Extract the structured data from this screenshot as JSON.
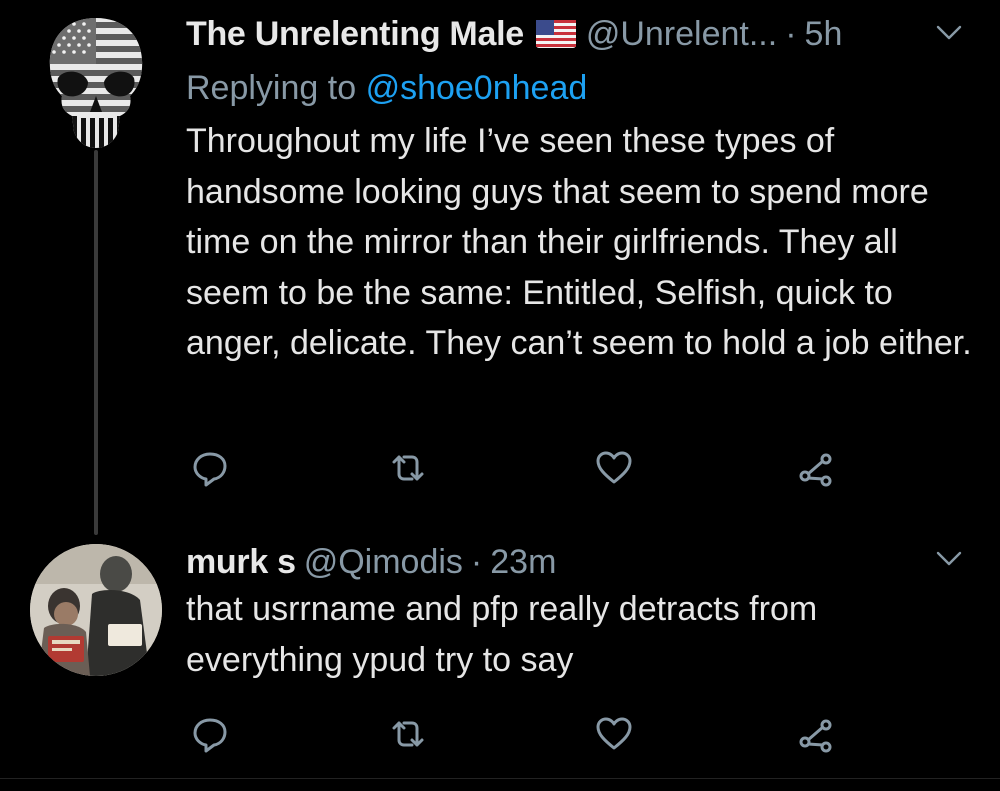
{
  "thread": [
    {
      "author": {
        "display_name": "The Unrelenting Male",
        "flag_icon": "us-flag-icon",
        "handle": "@Unrelent...",
        "separator": "·",
        "time": "5h"
      },
      "replying_to": {
        "prefix": "Replying to",
        "mention": "@shoe0nhead"
      },
      "text": "Throughout my life I’ve seen these types of handsome looking guys that seem to spend more time on the mirror than their girlfriends. They all seem to be the same: Entitled, Selfish, quick to anger, delicate. They can’t seem to hold a job either."
    },
    {
      "author": {
        "display_name": "murk s",
        "handle": "@Qimodis",
        "separator": "·",
        "time": "23m"
      },
      "text": "that usrrname and pfp really detracts from everything ypud try to say"
    }
  ],
  "icons": {
    "reply": "reply-icon",
    "retweet": "retweet-icon",
    "like": "heart-icon",
    "share": "share-icon",
    "menu": "chevron-down-icon"
  },
  "colors": {
    "background": "#000000",
    "text": "#e6e6e6",
    "muted": "#8899a6",
    "link": "#1da1f2"
  }
}
